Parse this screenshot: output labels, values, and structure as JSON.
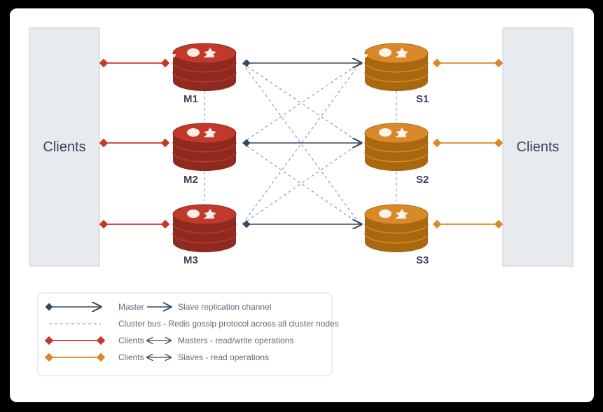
{
  "clients_left_label": "Clients",
  "clients_right_label": "Clients",
  "masters": [
    {
      "label": "M1"
    },
    {
      "label": "M2"
    },
    {
      "label": "M3"
    }
  ],
  "slaves": [
    {
      "label": "S1"
    },
    {
      "label": "S2"
    },
    {
      "label": "S3"
    }
  ],
  "legend": {
    "row1_a": "Master",
    "row1_b": "Slave replication channel",
    "row2": "Cluster bus - Redis gossip protocol across all cluster nodes",
    "row3_a": "Clients",
    "row3_b": "Masters - read/write operations",
    "row4_a": "Clients",
    "row4_b": "Slaves - read operations"
  },
  "colors": {
    "master": "#c0392b",
    "master_dark": "#8e2a20",
    "slave": "#d98a28",
    "slave_dark": "#a96710",
    "client_box": "#e7ebee",
    "client_border": "#c9cfd6",
    "repl": "#34495e",
    "bus": "#6f8fb0",
    "cm": "#c0392b",
    "cs": "#d98a28"
  }
}
